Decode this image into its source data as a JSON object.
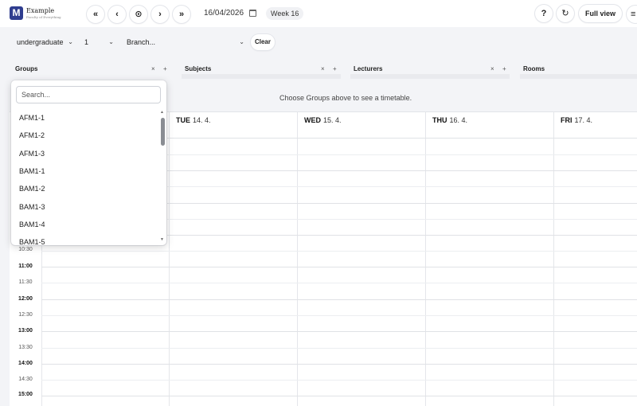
{
  "brand": {
    "logo_letter": "M",
    "name": "Example",
    "subtitle": "Faculty of Everything"
  },
  "toolbar": {
    "first": "«",
    "prev": "‹",
    "today": "⊙",
    "next": "›",
    "last": "»",
    "date": "16/04/2026",
    "week": "Week 16",
    "help": "?",
    "refresh": "↻",
    "full_view": "Full view",
    "menu": "≡"
  },
  "filters": {
    "level": "undergraduate",
    "year": "1",
    "branch": "Branch...",
    "clear": "Clear"
  },
  "groups_bar": {
    "groups": "Groups",
    "subjects": "Subjects",
    "lecturers": "Lecturers",
    "rooms": "Rooms",
    "remove": "×",
    "add": "+"
  },
  "message": "Choose Groups above to see a timetable.",
  "days": [
    {
      "name": "TUE",
      "date": "14. 4."
    },
    {
      "name": "WED",
      "date": "15. 4."
    },
    {
      "name": "THU",
      "date": "16. 4."
    },
    {
      "name": "FRI",
      "date": "17. 4."
    }
  ],
  "times": [
    "10:30",
    "11:00",
    "11:30",
    "12:00",
    "12:30",
    "13:00",
    "13:30",
    "14:00",
    "14:30",
    "15:00"
  ],
  "dropdown": {
    "search_placeholder": "Search...",
    "options": [
      "AFM1-1",
      "AFM1-2",
      "AFM1-3",
      "BAM1-1",
      "BAM1-2",
      "BAM1-3",
      "BAM1-4",
      "BAM1-5"
    ]
  },
  "colors": {
    "accent": "#2f3d8f",
    "background": "#f3f4f7"
  }
}
